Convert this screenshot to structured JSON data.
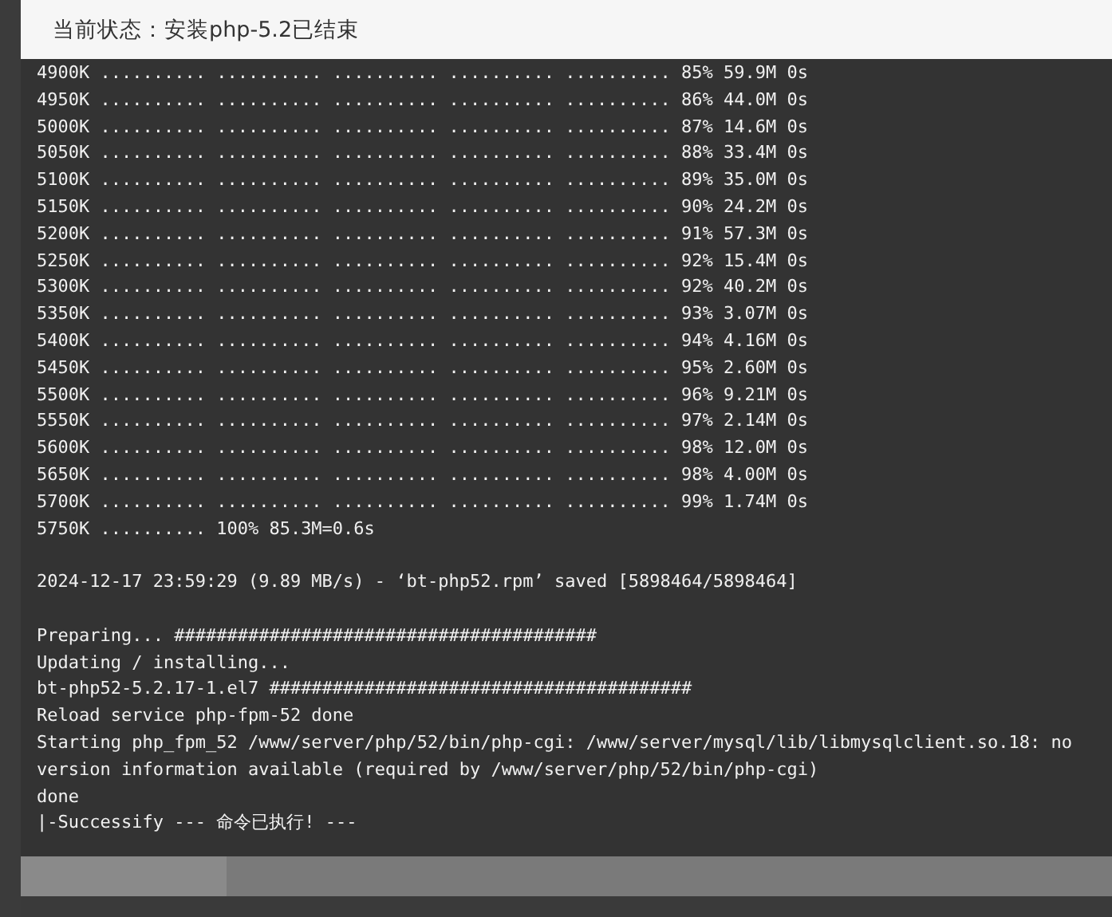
{
  "dialog": {
    "title": "当前状态：安装php-5.2已结束"
  },
  "terminal": {
    "blocks": [
      {
        "lines": [
          "4900K .......... .......... .......... .......... .......... 85% 59.9M 0s",
          "4950K .......... .......... .......... .......... .......... 86% 44.0M 0s",
          "5000K .......... .......... .......... .......... .......... 87% 14.6M 0s",
          "5050K .......... .......... .......... .......... .......... 88% 33.4M 0s",
          "5100K .......... .......... .......... .......... .......... 89% 35.0M 0s",
          "5150K .......... .......... .......... .......... .......... 90% 24.2M 0s",
          "5200K .......... .......... .......... .......... .......... 91% 57.3M 0s",
          "5250K .......... .......... .......... .......... .......... 92% 15.4M 0s",
          "5300K .......... .......... .......... .......... .......... 92% 40.2M 0s",
          "5350K .......... .......... .......... .......... .......... 93% 3.07M 0s",
          "5400K .......... .......... .......... .......... .......... 94% 4.16M 0s",
          "5450K .......... .......... .......... .......... .......... 95% 2.60M 0s",
          "5500K .......... .......... .......... .......... .......... 96% 9.21M 0s",
          "5550K .......... .......... .......... .......... .......... 97% 2.14M 0s",
          "5600K .......... .......... .......... .......... .......... 98% 12.0M 0s",
          "5650K .......... .......... .......... .......... .......... 98% 4.00M 0s",
          "5700K .......... .......... .......... .......... .......... 99% 1.74M 0s",
          "5750K .......... 100% 85.3M=0.6s"
        ]
      },
      {
        "lines": [
          "2024-12-17 23:59:29 (9.89 MB/s) - ‘bt-php52.rpm’ saved [5898464/5898464]"
        ]
      },
      {
        "lines": [
          "Preparing... ########################################",
          "Updating / installing...",
          "bt-php52-5.2.17-1.el7 ########################################",
          "Reload service php-fpm-52 done",
          "Starting php_fpm_52 /www/server/php/52/bin/php-cgi: /www/server/mysql/lib/libmysqlclient.so.18: no version information available (required by /www/server/php/52/bin/php-cgi)",
          "done",
          "|-Successify --- 命令已执行! ---"
        ]
      }
    ]
  }
}
